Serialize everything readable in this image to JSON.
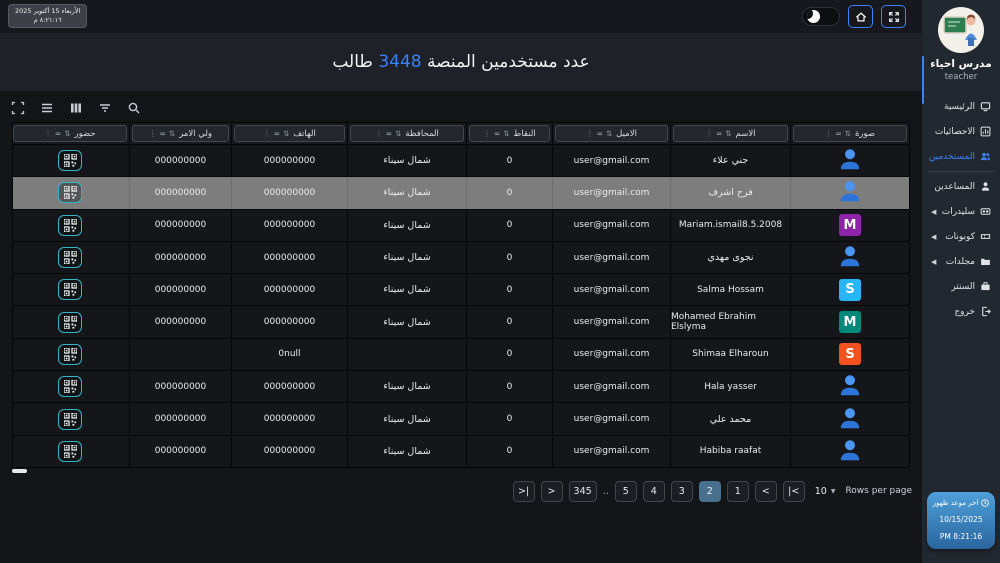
{
  "topbar": {
    "date_badge": {
      "line1": "الأربعاء 15 أكتوبر 2025",
      "line2": "٨:٢١:١٦ م"
    }
  },
  "title": {
    "prefix": "عدد مستخدمين المنصة",
    "count": "3448",
    "suffix": "طالب"
  },
  "sidebar": {
    "profile": {
      "name": "مدرس احياء",
      "role": "teacher"
    },
    "items": [
      {
        "label": "الرئيسية",
        "icon": "home-icon",
        "active": false,
        "arrow": false
      },
      {
        "label": "الاحصائيات",
        "icon": "stats-icon",
        "active": false,
        "arrow": false
      },
      {
        "label": "المستخدمين",
        "icon": "users-icon",
        "active": true,
        "arrow": false
      },
      {
        "label": "المساعدين",
        "icon": "assistants-icon",
        "active": false,
        "arrow": false
      },
      {
        "label": "سليدرات",
        "icon": "sliders-icon",
        "active": false,
        "arrow": true
      },
      {
        "label": "كوبونات",
        "icon": "coupons-icon",
        "active": false,
        "arrow": true
      },
      {
        "label": "مجلدات",
        "icon": "folders-icon",
        "active": false,
        "arrow": true
      },
      {
        "label": "السنتر",
        "icon": "center-icon",
        "active": false,
        "arrow": false
      },
      {
        "label": "خروج",
        "icon": "logout-icon",
        "active": false,
        "arrow": false
      }
    ],
    "last_seen": {
      "label": "اخر موعد ظهور",
      "date": "10/15/2025",
      "time": "PM 8:21:16"
    }
  },
  "table": {
    "columns": [
      {
        "label": "صورة"
      },
      {
        "label": "الاسم"
      },
      {
        "label": "الاميل"
      },
      {
        "label": "النقاط"
      },
      {
        "label": "المحافظة"
      },
      {
        "label": "الهاتف"
      },
      {
        "label": "ولي الامر"
      },
      {
        "label": "حضور"
      }
    ],
    "rows": [
      {
        "name": "جني علاء",
        "name_dir": "rtl",
        "email": "user@gmail.com",
        "points": "0",
        "governorate": "شمال سيناء",
        "phone": "000000000",
        "guardian": "000000000",
        "avatar": {
          "type": "person"
        },
        "selected": false
      },
      {
        "name": "فرح اشرف",
        "name_dir": "rtl",
        "email": "user@gmail.com",
        "points": "0",
        "governorate": "شمال سيناء",
        "phone": "000000000",
        "guardian": "000000000",
        "avatar": {
          "type": "person"
        },
        "selected": true
      },
      {
        "name": "Mariam.ismail8.5.2008",
        "name_dir": "ltr",
        "email": "user@gmail.com",
        "points": "0",
        "governorate": "شمال سيناء",
        "phone": "000000000",
        "guardian": "000000000",
        "avatar": {
          "type": "letter",
          "letter": "M",
          "color": "#8e24aa"
        },
        "selected": false
      },
      {
        "name": "نجوى مهدي",
        "name_dir": "rtl",
        "email": "user@gmail.com",
        "points": "0",
        "governorate": "شمال سيناء",
        "phone": "000000000",
        "guardian": "000000000",
        "avatar": {
          "type": "person"
        },
        "selected": false
      },
      {
        "name": "Salma Hossam",
        "name_dir": "ltr",
        "email": "user@gmail.com",
        "points": "0",
        "governorate": "شمال سيناء",
        "phone": "000000000",
        "guardian": "000000000",
        "avatar": {
          "type": "letter",
          "letter": "S",
          "color": "#29b6f6"
        },
        "selected": false
      },
      {
        "name": "Mohamed Ebrahim Elslyma",
        "name_dir": "ltr",
        "email": "user@gmail.com",
        "points": "0",
        "governorate": "شمال سيناء",
        "phone": "000000000",
        "guardian": "000000000",
        "avatar": {
          "type": "letter",
          "letter": "M",
          "color": "#00897b"
        },
        "selected": false
      },
      {
        "name": "Shimaa Elharoun",
        "name_dir": "ltr",
        "email": "user@gmail.com",
        "points": "0",
        "governorate": "",
        "phone": "0null",
        "guardian": "",
        "avatar": {
          "type": "letter",
          "letter": "S",
          "color": "#f4511e"
        },
        "selected": false
      },
      {
        "name": "Hala yasser",
        "name_dir": "ltr",
        "email": "user@gmail.com",
        "points": "0",
        "governorate": "شمال سيناء",
        "phone": "000000000",
        "guardian": "000000000",
        "avatar": {
          "type": "person"
        },
        "selected": false
      },
      {
        "name": "محمد علي",
        "name_dir": "rtl",
        "email": "user@gmail.com",
        "points": "0",
        "governorate": "شمال سيناء",
        "phone": "000000000",
        "guardian": "000000000",
        "avatar": {
          "type": "person"
        },
        "selected": false
      },
      {
        "name": "Habiba raafat",
        "name_dir": "ltr",
        "email": "user@gmail.com",
        "points": "0",
        "governorate": "شمال سيناء",
        "phone": "000000000",
        "guardian": "000000000",
        "avatar": {
          "type": "person"
        },
        "selected": false
      }
    ]
  },
  "pagination": {
    "rows_per_page_label": "Rows per page",
    "rows_per_page_value": "10",
    "first": "|<",
    "prev": "<",
    "next": ">",
    "last_nav": ">|",
    "pages": [
      "1",
      "2",
      "3",
      "4",
      "5"
    ],
    "active_page": "2",
    "ellipsis": "..",
    "last_page": "345"
  },
  "colors": {
    "accent": "#3b82f6",
    "active_page_bg": "#49708c",
    "qr_border": "#35b5c9"
  }
}
